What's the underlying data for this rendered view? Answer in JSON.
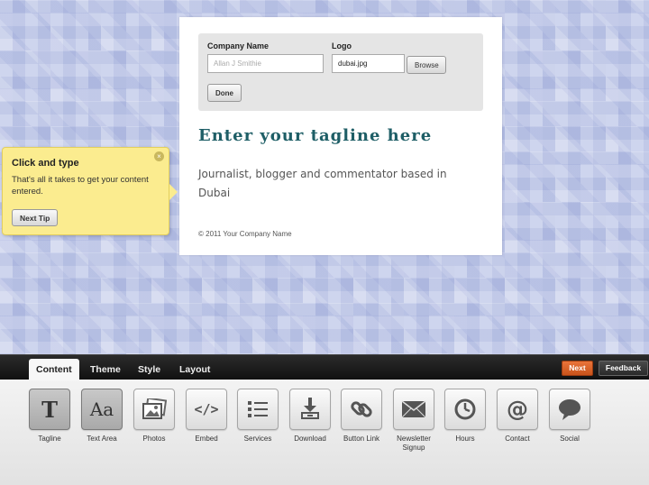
{
  "page": {
    "company_name_label": "Company Name",
    "company_name_placeholder": "Allan J Smithie",
    "logo_label": "Logo",
    "logo_value": "dubai.jpg",
    "browse_label": "Browse",
    "done_label": "Done",
    "tagline": "Enter your tagline here",
    "description": "Journalist, blogger and commentator based in Dubai",
    "copyright": "© 2011 Your Company Name"
  },
  "tip": {
    "title": "Click and type",
    "text": "That's all it takes to get your content entered.",
    "next_tip_label": "Next Tip",
    "close_glyph": "×"
  },
  "toolbar": {
    "tabs": [
      {
        "label": "Content",
        "active": true
      },
      {
        "label": "Theme"
      },
      {
        "label": "Style"
      },
      {
        "label": "Layout"
      }
    ],
    "next_label": "Next",
    "feedback_label": "Feedback",
    "accent_color": "#d9602a",
    "tools": [
      {
        "label": "Tagline",
        "icon": "tagline-icon",
        "glyph": "T",
        "selected": true
      },
      {
        "label": "Text Area",
        "icon": "text-area-icon",
        "glyph": "Aa",
        "selected": true
      },
      {
        "label": "Photos",
        "icon": "photos-icon"
      },
      {
        "label": "Embed",
        "icon": "embed-icon",
        "glyph": "</>"
      },
      {
        "label": "Services",
        "icon": "services-icon"
      },
      {
        "label": "Download",
        "icon": "download-icon"
      },
      {
        "label": "Button Link",
        "icon": "link-icon"
      },
      {
        "label": "Newsletter Signup",
        "icon": "envelope-icon"
      },
      {
        "label": "Hours",
        "icon": "clock-icon"
      },
      {
        "label": "Contact",
        "icon": "at-icon",
        "glyph": "@"
      },
      {
        "label": "Social",
        "icon": "speech-bubble-icon"
      }
    ]
  }
}
